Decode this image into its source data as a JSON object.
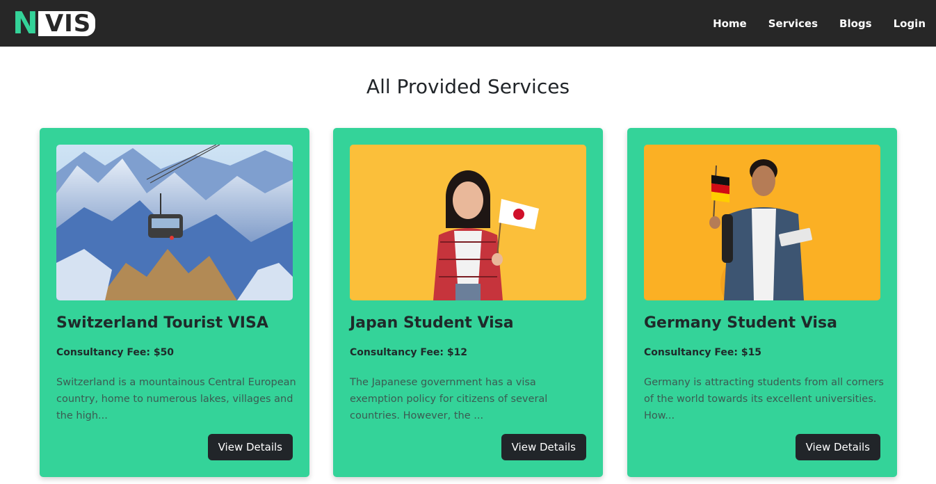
{
  "brand": {
    "logo_first": "N",
    "logo_rest": "VIS"
  },
  "nav": {
    "items": [
      "Home",
      "Services",
      "Blogs",
      "Login"
    ]
  },
  "page_title": "All Provided Services",
  "colors": {
    "navbar": "#272727",
    "accent": "#34d399",
    "button": "#212529"
  },
  "services": [
    {
      "title": "Switzerland Tourist VISA",
      "fee_label": "Consultancy Fee: $50",
      "description": "Switzerland is a mountainous Central European country, home to numerous lakes, villages and the high...",
      "button": "View Details"
    },
    {
      "title": "Japan Student Visa",
      "fee_label": "Consultancy Fee: $12",
      "description": "The Japanese government has a visa exemption policy for citizens of several countries. However, the ...",
      "button": "View Details"
    },
    {
      "title": "Germany Student Visa",
      "fee_label": "Consultancy Fee: $15",
      "description": "Germany is attracting students from all corners of the world towards its excellent universities. How...",
      "button": "View Details"
    }
  ]
}
